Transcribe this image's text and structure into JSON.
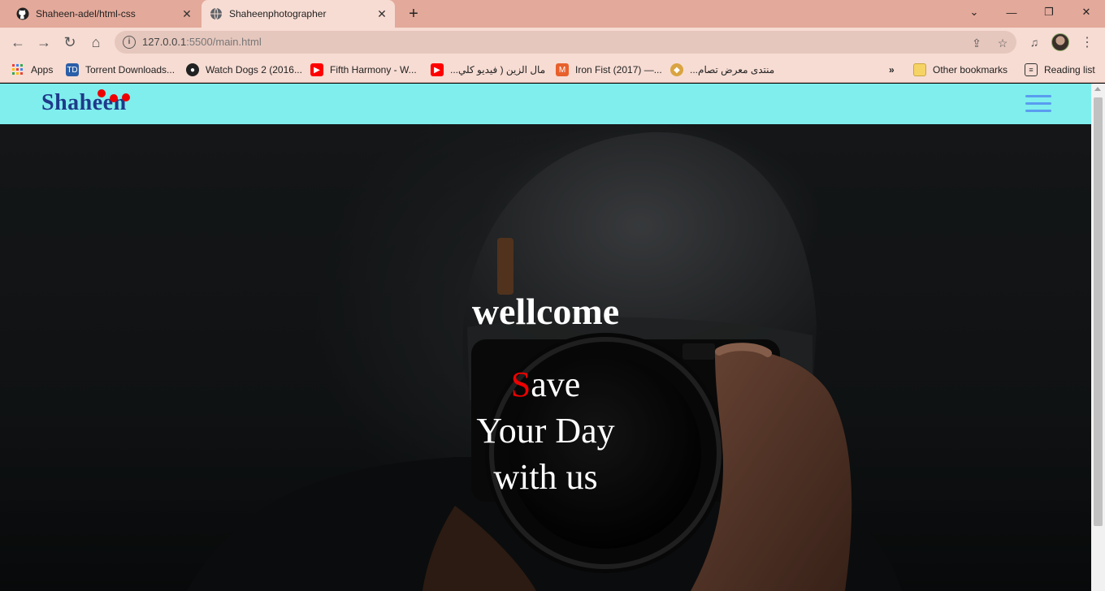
{
  "browser": {
    "tabs": [
      {
        "title": "Shaheen-adel/html-css",
        "icon": "github-icon",
        "active": false
      },
      {
        "title": "Shaheenphotographer",
        "icon": "globe-icon",
        "active": true
      }
    ],
    "new_tab": "+",
    "address": {
      "host": "127.0.0.1",
      "rest": ":5500/main.html"
    },
    "bookmarks": [
      {
        "label": "Apps",
        "icon": "apps-grid-icon"
      },
      {
        "label": "Torrent Downloads...",
        "icon": "torrent-icon"
      },
      {
        "label": "Watch Dogs 2 (2016...",
        "icon": "watch-dogs-icon"
      },
      {
        "label": "Fifth Harmony - W...",
        "icon": "youtube-icon"
      },
      {
        "label": "...مال الزين ( فيديو كلي",
        "icon": "youtube-icon"
      },
      {
        "label": "Iron Fist (2017) —...",
        "icon": "iron-fist-icon"
      },
      {
        "label": "...منتدى معرض تصام",
        "icon": "forum-icon"
      }
    ],
    "overflow": "»",
    "other_bookmarks": "Other bookmarks",
    "reading_list": "Reading list"
  },
  "site": {
    "logo": "Shaheen",
    "hero": {
      "welcome": "wellcome",
      "accent_letter": "S",
      "line1_rest": "ave",
      "line2": "Your Day",
      "line3": "with us"
    }
  },
  "colors": {
    "header_bg": "#7feeed",
    "logo": "#1f3a8a",
    "accent": "#ee0000",
    "tab_strip": "#e3a99a",
    "toolbar": "#f7dcd3"
  }
}
